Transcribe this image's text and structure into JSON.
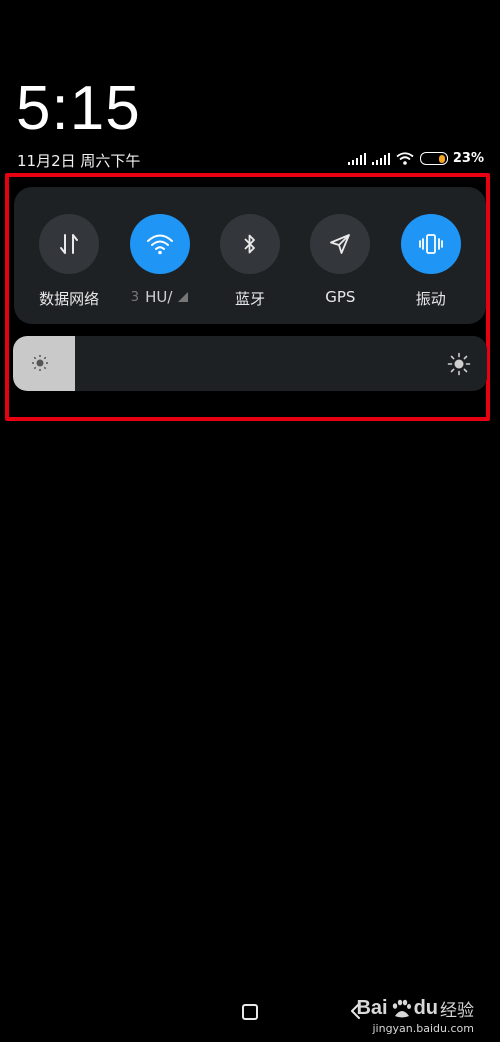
{
  "lock": {
    "time": "5:15",
    "date": "11月2日 周六下午"
  },
  "status_bar": {
    "battery_percent": "23%",
    "battery_color": "#f5a623"
  },
  "quick_toggles": [
    {
      "id": "mobile-data",
      "label": "数据网络",
      "active": false,
      "icon": "data-arrows-icon"
    },
    {
      "id": "wifi",
      "label_prefix": "3",
      "label": "HU/",
      "active": true,
      "icon": "wifi-icon"
    },
    {
      "id": "bluetooth",
      "label": "蓝牙",
      "active": false,
      "icon": "bluetooth-icon"
    },
    {
      "id": "gps",
      "label": "GPS",
      "active": false,
      "icon": "location-arrow-icon"
    },
    {
      "id": "vibrate",
      "label": "振动",
      "active": true,
      "icon": "vibrate-icon"
    }
  ],
  "accent_color": "#1f95f5",
  "brightness": {
    "level": 0.13
  },
  "watermark": {
    "brand": "Bai",
    "brand_suffix": "du",
    "cn": "经验",
    "url": "jingyan.baidu.com"
  }
}
